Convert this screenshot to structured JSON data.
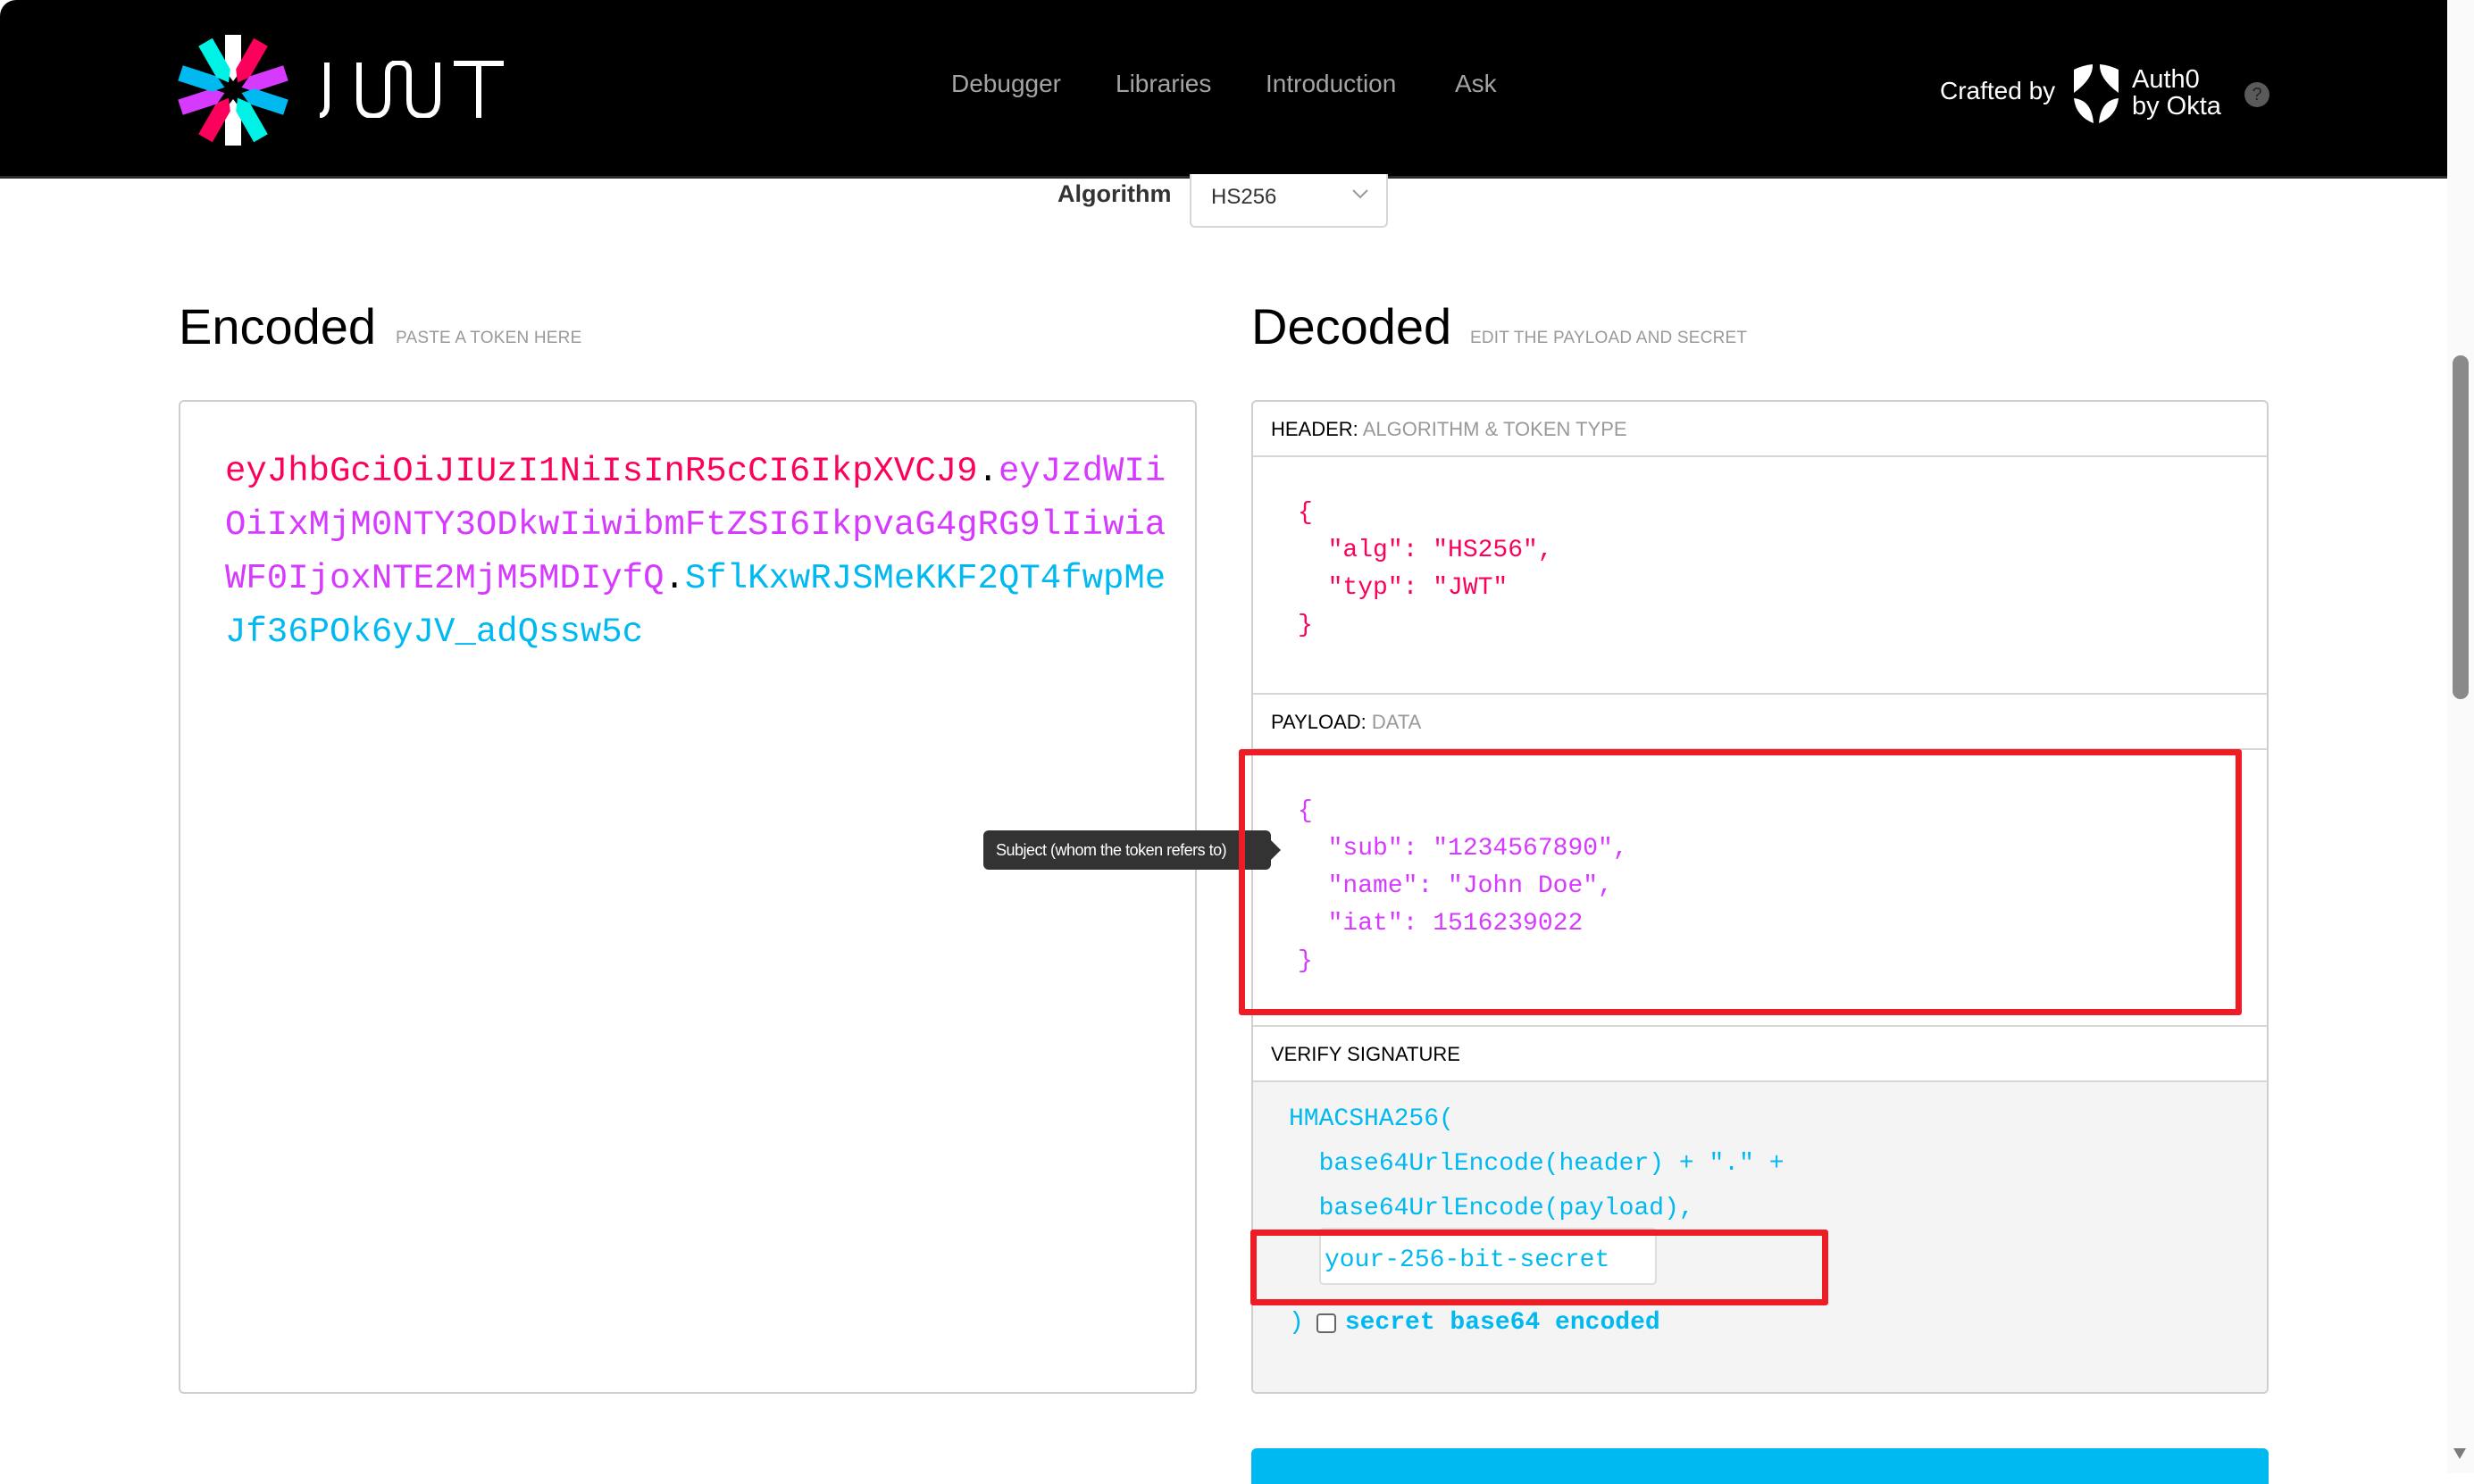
{
  "navbar": {
    "brand": "JWT",
    "links": [
      "Debugger",
      "Libraries",
      "Introduction",
      "Ask"
    ],
    "crafted_by": "Crafted by",
    "partner_line1": "Auth0",
    "partner_line2": "by Okta",
    "help_icon": "?"
  },
  "algorithm": {
    "label": "Algorithm",
    "selected": "HS256"
  },
  "encoded": {
    "title": "Encoded",
    "subtitle": "PASTE A TOKEN HERE",
    "token_header": "eyJhbGciOiJIUzI1NiIsInR5cCI6IkpXVCJ9",
    "token_payload": "eyJzdWIiOiIxMjM0NTY3ODkwIiwibmFtZSI6IkpvaG4gRG9lIiwiaWF0IjoxNTE2MjM5MDIyfQ",
    "token_signature": "SflKxwRJSMeKKF2QT4fwpMeJf36POk6yJV_adQssw5c",
    "separator": "."
  },
  "decoded": {
    "title": "Decoded",
    "subtitle": "EDIT THE PAYLOAD AND SECRET",
    "header": {
      "label": "HEADER:",
      "sublabel": "ALGORITHM & TOKEN TYPE",
      "json": "{\n  \"alg\": \"HS256\",\n  \"typ\": \"JWT\"\n}"
    },
    "payload": {
      "label": "PAYLOAD:",
      "sublabel": "DATA",
      "json": "{\n  \"sub\": \"1234567890\",\n  \"name\": \"John Doe\",\n  \"iat\": 1516239022\n}"
    },
    "signature": {
      "label": "VERIFY SIGNATURE",
      "line1": "HMACSHA256(",
      "line2": "  base64UrlEncode(header) + \".\" +",
      "line3": "  base64UrlEncode(payload),",
      "secret_value": "your-256-bit-secret",
      "close_paren": ")",
      "base64_label": "secret base64 encoded",
      "base64_checked": false
    }
  },
  "tooltip": {
    "text": "Subject (whom the token refers to)"
  },
  "colors": {
    "header": "#fb015b",
    "payload": "#d63aff",
    "signature": "#00b9f1",
    "annotation": "#ee1c25"
  }
}
